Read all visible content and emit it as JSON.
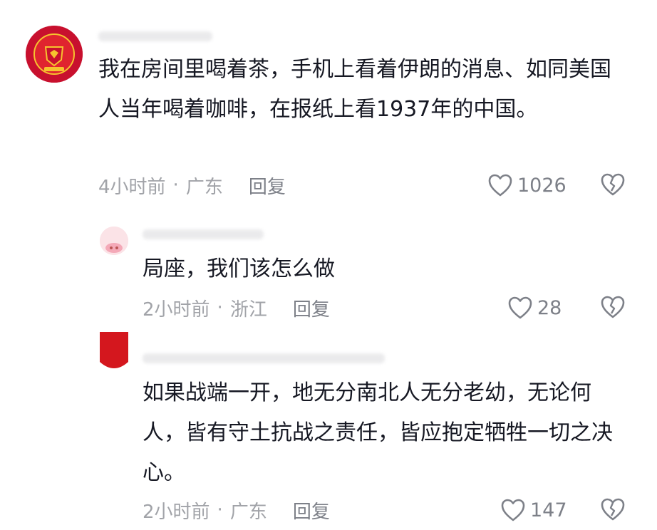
{
  "comments": [
    {
      "text": "我在房间里喝着茶，手机上看着伊朗的消息、如同美国人当年喝着咖啡，在报纸上看1937年的中国。",
      "time": "4小时前",
      "location": "广东",
      "reply_label": "回复",
      "likes": "1026"
    },
    {
      "text": "局座，我们该怎么做",
      "time": "2小时前",
      "location": "浙江",
      "reply_label": "回复",
      "likes": "28"
    },
    {
      "text": "如果战端一开，地无分南北人无分老幼，无论何人，皆有守土抗战之责任，皆应抱定牺牲一切之决心。",
      "time": "2小时前",
      "location": "广东",
      "reply_label": "回复",
      "likes": "147"
    }
  ],
  "separator": "·",
  "icons": {
    "like": "heart-outline-icon",
    "dislike": "broken-heart-icon"
  },
  "colors": {
    "text": "#161823",
    "meta": "#a1a3a8",
    "accent_red": "#c8102e"
  }
}
